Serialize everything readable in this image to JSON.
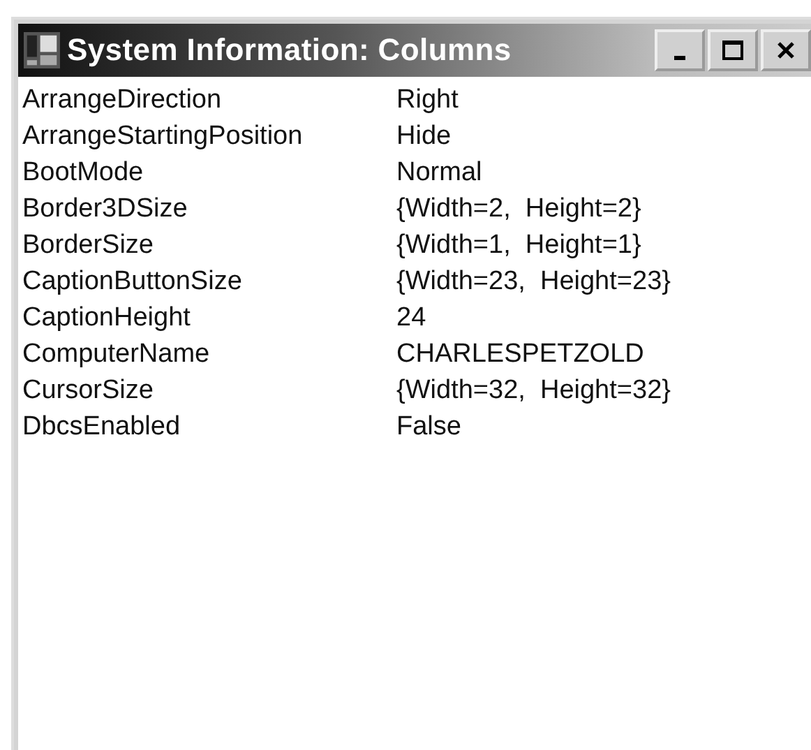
{
  "window": {
    "title": "System Information: Columns"
  },
  "rows": [
    {
      "name": "ArrangeDirection",
      "value": "Right"
    },
    {
      "name": "ArrangeStartingPosition",
      "value": "Hide"
    },
    {
      "name": "BootMode",
      "value": "Normal"
    },
    {
      "name": "Border3DSize",
      "value": "{Width=2,  Height=2}"
    },
    {
      "name": "BorderSize",
      "value": "{Width=1,  Height=1}"
    },
    {
      "name": "CaptionButtonSize",
      "value": "{Width=23,  Height=23}"
    },
    {
      "name": "CaptionHeight",
      "value": "24"
    },
    {
      "name": "ComputerName",
      "value": "CHARLESPETZOLD"
    },
    {
      "name": "CursorSize",
      "value": "{Width=32,  Height=32}"
    },
    {
      "name": "DbcsEnabled",
      "value": "False"
    }
  ]
}
